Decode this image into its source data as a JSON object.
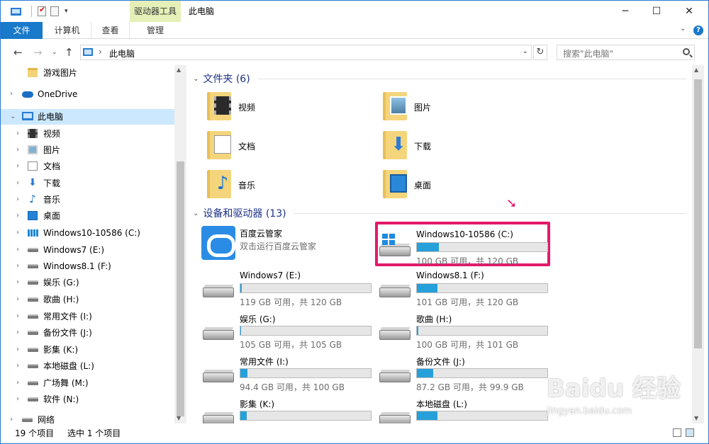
{
  "title_bar": {
    "tools_tab": "驱动器工具",
    "title": "此电脑",
    "minimize": "─",
    "maximize": "☐",
    "close": "✕"
  },
  "ribbon": {
    "tabs": [
      "文件",
      "计算机",
      "查看",
      "管理"
    ],
    "help": "?"
  },
  "address": {
    "crumb": "此电脑",
    "search_placeholder": "搜索\"此电脑\""
  },
  "nav_pane": {
    "items": [
      {
        "label": "游戏图片",
        "icon": "folder-icon",
        "level": 1
      },
      {
        "label": "OneDrive",
        "icon": "onedrive-cloud-icon",
        "level": 0
      },
      {
        "label": "此电脑",
        "icon": "this-pc-icon",
        "level": 0,
        "selected": true
      },
      {
        "label": "视频",
        "icon": "videos-icon",
        "level": 1
      },
      {
        "label": "图片",
        "icon": "pictures-icon",
        "level": 1
      },
      {
        "label": "文档",
        "icon": "documents-icon",
        "level": 1
      },
      {
        "label": "下载",
        "icon": "downloads-icon",
        "level": 1
      },
      {
        "label": "音乐",
        "icon": "music-icon",
        "level": 1
      },
      {
        "label": "桌面",
        "icon": "desktop-icon",
        "level": 1
      },
      {
        "label": "Windows10-10586 (C:)",
        "icon": "windows-drive-icon",
        "level": 1
      },
      {
        "label": "Windows7 (E:)",
        "icon": "drive-icon",
        "level": 1
      },
      {
        "label": "Windows8.1 (F:)",
        "icon": "drive-icon",
        "level": 1
      },
      {
        "label": "娱乐 (G:)",
        "icon": "drive-icon",
        "level": 1
      },
      {
        "label": "歌曲 (H:)",
        "icon": "drive-icon",
        "level": 1
      },
      {
        "label": "常用文件 (I:)",
        "icon": "drive-icon",
        "level": 1
      },
      {
        "label": "备份文件 (J:)",
        "icon": "drive-icon",
        "level": 1
      },
      {
        "label": "影集 (K:)",
        "icon": "drive-icon",
        "level": 1
      },
      {
        "label": "本地磁盘 (L:)",
        "icon": "drive-icon",
        "level": 1
      },
      {
        "label": "广场舞 (M:)",
        "icon": "drive-icon",
        "level": 1
      },
      {
        "label": "软件 (N:)",
        "icon": "drive-icon",
        "level": 1
      },
      {
        "label": "网络",
        "icon": "network-icon",
        "level": 0
      }
    ]
  },
  "folders_group": {
    "header": "文件夹 (6)",
    "items": [
      {
        "label": "视频",
        "icon": "videos-folder-icon"
      },
      {
        "label": "图片",
        "icon": "pictures-folder-icon"
      },
      {
        "label": "文档",
        "icon": "documents-folder-icon"
      },
      {
        "label": "下载",
        "icon": "downloads-folder-icon"
      },
      {
        "label": "音乐",
        "icon": "music-folder-icon"
      },
      {
        "label": "桌面",
        "icon": "desktop-folder-icon"
      }
    ]
  },
  "devices_group": {
    "header": "设备和驱动器 (13)",
    "app": {
      "name": "百度云管家",
      "desc": "双击运行百度云管家"
    },
    "drives": [
      {
        "name": "Windows10-10586 (C:)",
        "free": "100 GB 可用，共 120 GB",
        "used_fraction": 0.17,
        "windows": true,
        "highlighted": true
      },
      {
        "name": "Windows7 (E:)",
        "free": "119 GB 可用，共 120 GB",
        "used_fraction": 0.01
      },
      {
        "name": "Windows8.1 (F:)",
        "free": "101 GB 可用，共 120 GB",
        "used_fraction": 0.16
      },
      {
        "name": "娱乐 (G:)",
        "free": "105 GB 可用，共 105 GB",
        "used_fraction": 0.0
      },
      {
        "name": "歌曲 (H:)",
        "free": "100 GB 可用，共 101 GB",
        "used_fraction": 0.01
      },
      {
        "name": "常用文件 (I:)",
        "free": "94.4 GB 可用，共 100 GB",
        "used_fraction": 0.056
      },
      {
        "name": "备份文件 (J:)",
        "free": "87.2 GB 可用，共 99.9 GB",
        "used_fraction": 0.127
      },
      {
        "name": "影集 (K:)",
        "free": "",
        "used_fraction": 0.05
      },
      {
        "name": "本地磁盘 (L:)",
        "free": "",
        "used_fraction": 0.16
      }
    ]
  },
  "status_bar": {
    "count": "19 个项目",
    "selected": "选中 1 个项目"
  },
  "watermark": {
    "text": "Baidu 经验",
    "url": "jingyan.baidu.com"
  },
  "colors": {
    "accent": "#1979ca",
    "selection": "#cce8ff",
    "drive_bar": "#26a0da",
    "highlight": "#e3196b"
  }
}
